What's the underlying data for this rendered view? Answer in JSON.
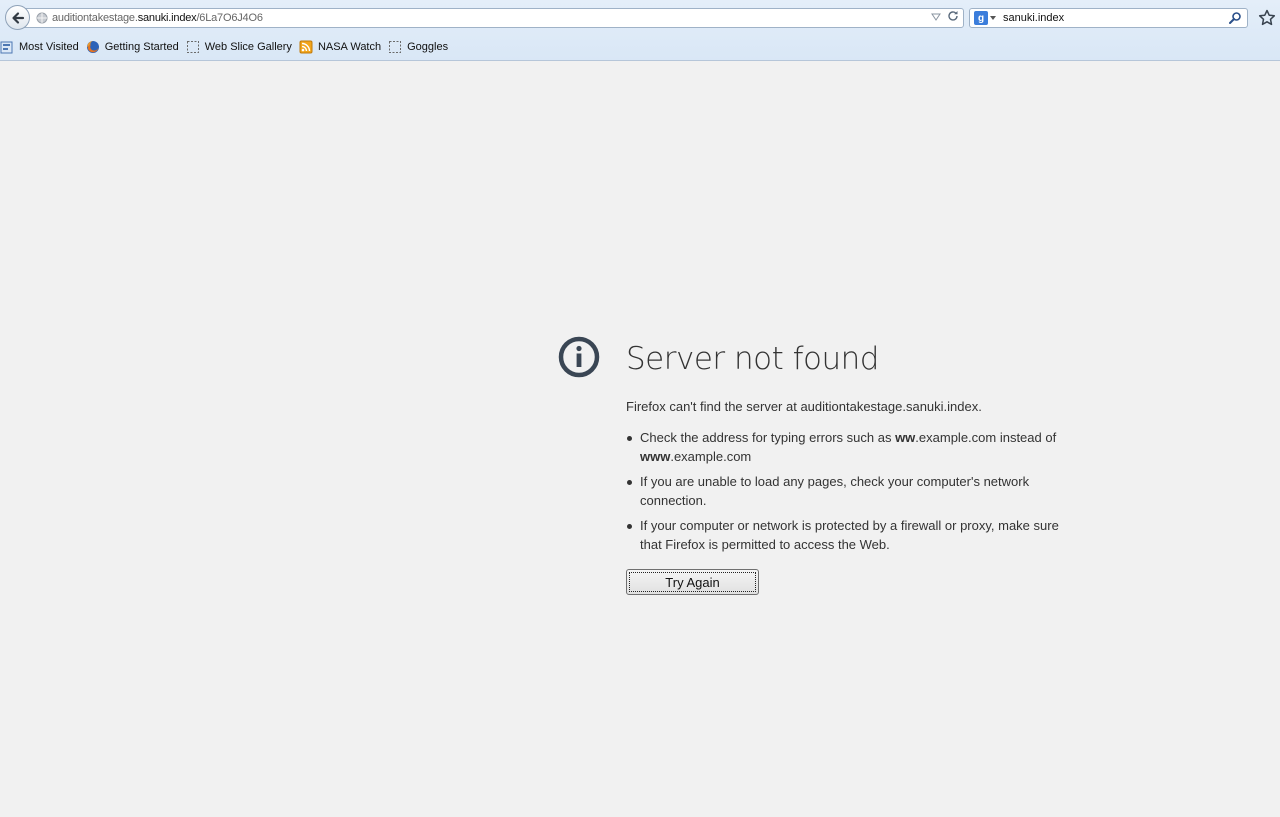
{
  "nav": {
    "url_prefix": "auditiontakestage.",
    "url_domain": "sanuki.index",
    "url_path": "/6La7O6J4O6"
  },
  "search": {
    "engine": "Google",
    "value": "sanuki.index"
  },
  "bookmarks": {
    "items": [
      {
        "label": "Most Visited",
        "icon": "most-visited-icon"
      },
      {
        "label": "Getting Started",
        "icon": "firefox-icon"
      },
      {
        "label": "Web Slice Gallery",
        "icon": "web-slice-icon"
      },
      {
        "label": "NASA Watch",
        "icon": "rss-feed-icon"
      },
      {
        "label": "Goggles",
        "icon": "web-slice-icon"
      }
    ]
  },
  "error": {
    "title": "Server not found",
    "description": "Firefox can't find the server at auditiontakestage.sanuki.index.",
    "tip1_pre": "Check the address for typing errors such as ",
    "tip1_bold1": "ww",
    "tip1_mid": ".example.com instead of ",
    "tip1_bold2": "www",
    "tip1_post": ".example.com",
    "tip2": "If you are unable to load any pages, check your computer's network connection.",
    "tip3": "If your computer or network is protected by a firewall or proxy, make sure that Firefox is permitted to access the Web.",
    "button": "Try Again"
  },
  "colors": {
    "page_bg": "#f1f1f1",
    "toolbar_bg": "#d9e7f6",
    "text": "#333333",
    "icon": "#3a4654"
  }
}
